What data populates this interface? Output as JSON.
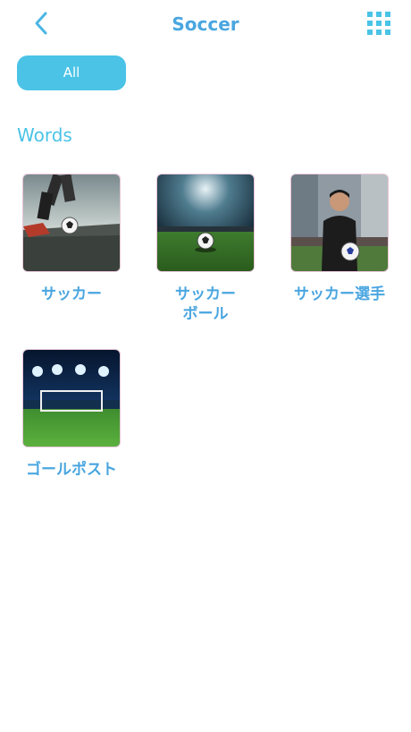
{
  "header": {
    "title": "Soccer",
    "back_icon": "chevron-left-icon",
    "grid_icon": "grid-icon"
  },
  "filter": {
    "all_label": "All"
  },
  "section": {
    "title": "Words"
  },
  "words": [
    {
      "label": "サッカー",
      "image": "soccer-kick-photo"
    },
    {
      "label": "サッカー\nボール",
      "image": "soccer-ball-stadium-photo"
    },
    {
      "label": "サッカー選手",
      "image": "soccer-player-photo"
    },
    {
      "label": "ゴールポスト",
      "image": "goalpost-stadium-photo"
    }
  ],
  "colors": {
    "accent": "#4ac3e6",
    "title_text": "#4aa6e0"
  }
}
